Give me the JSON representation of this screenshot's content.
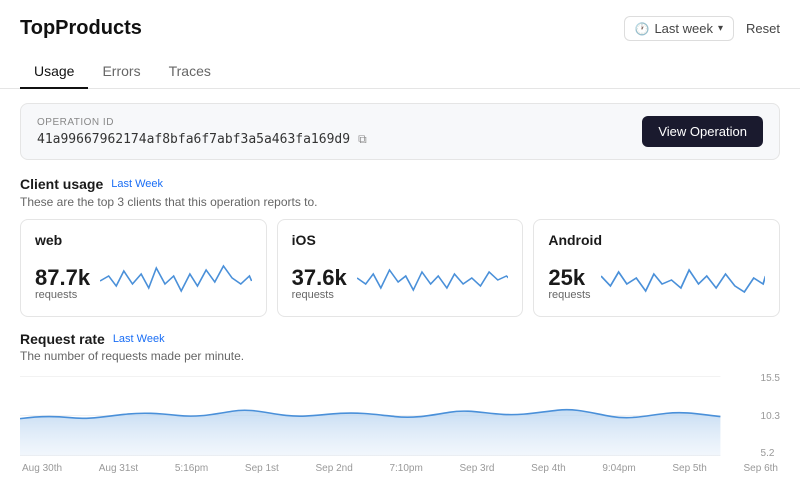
{
  "app": {
    "title": "TopProducts"
  },
  "header": {
    "time_selector_label": "Last week",
    "reset_label": "Reset"
  },
  "tabs": [
    {
      "label": "Usage",
      "active": true
    },
    {
      "label": "Errors",
      "active": false
    },
    {
      "label": "Traces",
      "active": false
    }
  ],
  "operation": {
    "label": "OPERATION ID",
    "id": "41a99667962174af8bfa6f7abf3a5a463fa169d9",
    "view_button_label": "View Operation"
  },
  "client_usage": {
    "title": "Client usage",
    "badge": "Last Week",
    "subtitle": "These are the top 3 clients that this operation reports to.",
    "clients": [
      {
        "name": "web",
        "value": "87.7k",
        "unit": "requests"
      },
      {
        "name": "iOS",
        "value": "37.6k",
        "unit": "requests"
      },
      {
        "name": "Android",
        "value": "25k",
        "unit": "requests"
      }
    ]
  },
  "request_rate": {
    "title": "Request rate",
    "badge": "Last Week",
    "subtitle": "The number of requests made per minute.",
    "y_labels": [
      "15.5",
      "10.3",
      "5.2"
    ],
    "x_labels": [
      "Aug 30th",
      "Aug 31st",
      "5:16pm",
      "Sep 1st",
      "Sep 2nd",
      "7:10pm",
      "Sep 3rd",
      "Sep 4th",
      "9:04pm",
      "Sep 5th",
      "Sep 6th"
    ]
  }
}
